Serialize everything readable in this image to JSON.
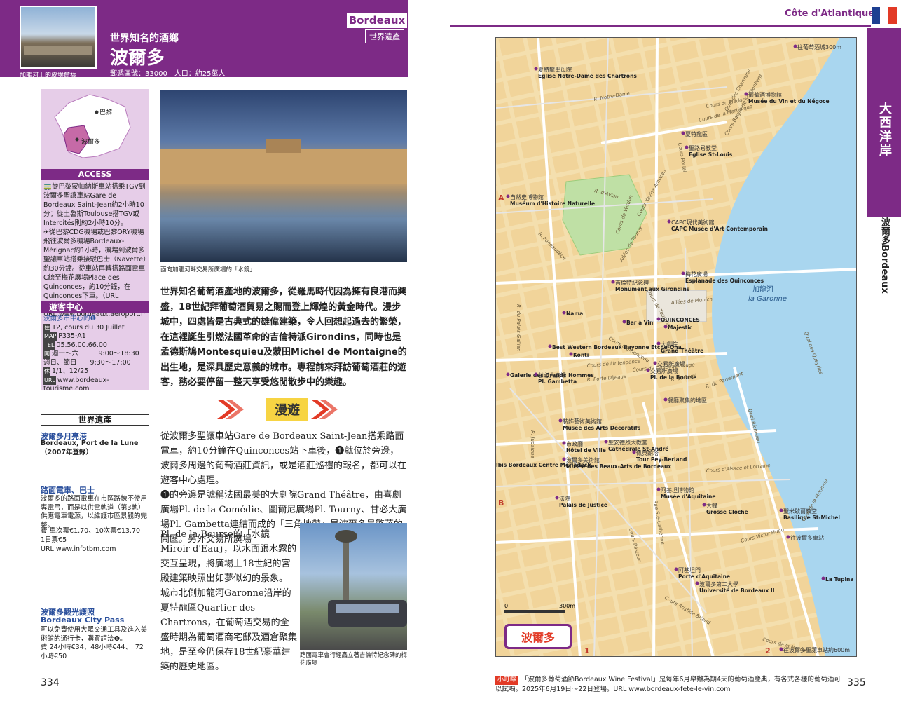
{
  "left": {
    "header": {
      "tag": "Bordeaux",
      "subtitle": "世界知名的酒鄉",
      "heritage_badge": "世界遺產",
      "title": "波爾多",
      "meta": "郵遞區號：33000　人口：約25萬人",
      "thumb_caption": "加龍河上的皮埃爾橋"
    },
    "sidebar": {
      "map_labels": [
        "巴黎",
        "波爾多"
      ],
      "access_title": "ACCESS",
      "access_text": "🚃從巴黎蒙帕納斯車站搭乘TGV到波爾多聖讓車站Gare de Bordeaux Saint-Jean約2小時10分；從土魯斯Toulouse搭TGV或Intercités則約2小時10分。\n✈從巴黎CDG機場或巴黎ORY機場飛往波爾多機場Bordeaux-Mérignac約1小時，機場到波爾多聖讓車站搭乘接駁巴士（Navette）約30分鐘。從車站再轉搭路面電車C線至梅花廣場Place des Quinconces，約10分鐘，在Quinconces下車。（URL www.infotbm.com）\nURL www.bordeaux.aeroport.fr",
      "info_title": "遊客中心",
      "info_office": "波爾多市中心的❶",
      "info_lines": [
        {
          "label": "住",
          "text": "12, cours du 30 Juillet"
        },
        {
          "label": "MAP",
          "text": "P335-A1"
        },
        {
          "label": "TEL",
          "text": "05.56.00.66.00"
        },
        {
          "label": "開",
          "text": "週一～六　　　9:00～18:30"
        },
        {
          "label": "",
          "text": "週日、節日　　9:30～17:00"
        },
        {
          "label": "休",
          "text": "1/1、12/25"
        },
        {
          "label": "URL",
          "text": "www.bordeaux-tourisme.com"
        }
      ]
    },
    "world_heritage": {
      "section_title": "世界遺產",
      "name_zh": "波爾多月亮港",
      "name_fr": "Bordeaux, Port de la Lune",
      "year": "（2007年登錄）"
    },
    "tram": {
      "title": "路面電車、巴士",
      "text": "波爾多的路面電車在市區路線不使用專電弓，而是以供電軌道（第3軌）供應電車電源，以維護市區景觀的完整。",
      "fares": "費 單次票€1.70、10次票€13.70　　1日票€5",
      "url": "URL www.infotbm.com"
    },
    "citypass": {
      "title": "波爾多觀光護照",
      "title_en": "Bordeaux City Pass",
      "text": "可以免費使用大眾交通工具及進入美術館的通行卡，購買請洽❶。",
      "fares": "費 24小時€34、48小時€44、　72小時€50"
    },
    "photo1_caption": "面向加龍河畔交易所廣場的「水鏡」",
    "intro": "世界知名葡萄酒產地的波爾多，從羅馬時代因為擁有良港而興盛，18世紀拜葡萄酒貿易之賜而登上輝煌的黃金時代。漫步城中，四處皆是古典式的雄偉建築，令人回想起過去的繁榮，在這裡誕生引燃法國革命的吉倫特派Girondins，同時也是孟德斯鳩Montesquieu及蒙田Michel de Montaigne的出生地，是深具歷史意義的城市。專程前來拜訪葡萄酒莊的遊客，務必要停留一整天享受悠閒散步中的樂趣。",
    "walk_label": "漫遊",
    "body1": "從波爾多聖讓車站Gare de Bordeaux Saint-Jean搭乘路面電車，約10分鐘在Quinconces站下車後，❶就位於旁邊，波爾多周邊的葡萄酒莊資訊，或是酒莊巡禮的報名，都可以在遊客中心處理。\n❶的旁邊是號稱法國最美的大劇院Grand Théâtre，由喜劇廣場Pl. de la Comédie、圖爾尼廣場Pl. Tourny、甘必大廣場Pl. Gambetta連結而成的「三角地帶」是波爾多最繁華的鬧區。另外交易所廣場",
    "body2": "Pl. de la Bourse的「水鏡Miroir d'Eau」，以水面跟水霧的交互呈現，將廣場上18世紀的宮殿建築映照出如夢似幻的景象。\n城市北側加龍河Garonne沿岸的夏特龍區Quartier des Chartrons，在葡萄酒交易的全盛時期為葡萄酒商宅邸及酒倉聚集地，是至今仍保存18世紀豪華建築的歷史地區。",
    "photo2_caption": "路面電車會行經矗立著吉倫特紀念碑的梅花廣場",
    "page_number": "334"
  },
  "right": {
    "header_title": "Côte d'Atlantique",
    "tab_region": "大西洋岸",
    "tab_city": "波爾多Bordeaux",
    "map": {
      "city_badge": "波爾多",
      "scale_start": "0",
      "scale_end": "300m",
      "grid": [
        "A",
        "B",
        "1",
        "2"
      ],
      "river_zh": "加龍河",
      "river_fr": "la Garonne",
      "labels": [
        {
          "zh": "往葡萄酒城300m",
          "fr": ""
        },
        {
          "zh": "夏特龍聖母院",
          "fr": "Eglise Notre-Dame des Chartrons"
        },
        {
          "zh": "葡萄酒博物館",
          "fr": "Musée du Vin et du Négoce"
        },
        {
          "zh": "夏特龍區",
          "fr": ""
        },
        {
          "zh": "聖路易教堂",
          "fr": "Eglise St-Louis"
        },
        {
          "zh": "自然史博物館",
          "fr": "Muséum d'Histoire Naturelle"
        },
        {
          "zh": "CAPC現代美術館",
          "fr": "CAPC Musée d'Art Contemporain"
        },
        {
          "zh": "梅花廣場",
          "fr": "Esplanade des Quinconces"
        },
        {
          "zh": "吉倫特紀念碑",
          "fr": "Monument aux Girondins"
        },
        {
          "zh": "",
          "fr": "QUINCONCES"
        },
        {
          "zh": "大劇院",
          "fr": "Grand Théâtre"
        },
        {
          "zh": "",
          "fr": "Galerie des Grands Hommes"
        },
        {
          "zh": "",
          "fr": "Best Western Bordeaux Bayonne Etche-Ona"
        },
        {
          "zh": "交易所廣場",
          "fr": "Pl. de la Bourse"
        },
        {
          "zh": "甘必大廣場",
          "fr": "Pl. Gambetta"
        },
        {
          "zh": "裝飾藝術美術館",
          "fr": "Musée des Arts Décoratifs"
        },
        {
          "zh": "聖安德烈大教堂",
          "fr": "Cathédrale St-André"
        },
        {
          "zh": "佩貝朗塔",
          "fr": "Tour Pey-Berland"
        },
        {
          "zh": "市政廳",
          "fr": "Hôtel de Ville"
        },
        {
          "zh": "波爾多美術館",
          "fr": "Musée des Beaux-Arts de Bordeaux"
        },
        {
          "zh": "",
          "fr": "Ibis Bordeaux Centre Mériadeck"
        },
        {
          "zh": "法院",
          "fr": "Palais de Justice"
        },
        {
          "zh": "阿基坦博物館",
          "fr": "Musée d'Aquitaine"
        },
        {
          "zh": "大鐘",
          "fr": "Grosse Cloche"
        },
        {
          "zh": "聖米歇爾教堂",
          "fr": "Basilique St-Michel"
        },
        {
          "zh": "阿基坦門",
          "fr": "Porte d'Aquitaine"
        },
        {
          "zh": "波爾多第二大學",
          "fr": "Université de Bordeaux II"
        },
        {
          "zh": "往波爾多聖讓車站約600m",
          "fr": ""
        },
        {
          "zh": "往波爾多車站",
          "fr": ""
        },
        {
          "zh": "餐廳聚集的地區",
          "fr": ""
        },
        {
          "zh": "交易所廣場",
          "fr": ""
        },
        {
          "zh": "",
          "fr": "Nama"
        },
        {
          "zh": "",
          "fr": "Bar à Vin"
        },
        {
          "zh": "",
          "fr": "Majestic"
        },
        {
          "zh": "",
          "fr": "Konti"
        },
        {
          "zh": "",
          "fr": "La Tupina"
        }
      ],
      "streets": [
        "Cours Xavier Arnozan",
        "Quai des Chartrons",
        "Cours de Verdun",
        "Allées de Tourny",
        "Cours du Chapeau Rouge",
        "Cours de l'Intendance",
        "Rue Ste-Catherine",
        "Cours Victor Hugo",
        "Cours Pasteur",
        "Cours Aristide Briand",
        "Cours d'Alsace et Lorraine",
        "Quai Richelieu",
        "Allées de Munich",
        "Cours Portal",
        "Cours de la Martinique",
        "R. Notre-Dame",
        "Cours du Médoc",
        "Cours Balguerie Stuttenberg",
        "R. Fondaudège",
        "Quai des Queyries",
        "Cours de Tournon",
        "R. du Palais Gallien",
        "R. d'Aviau",
        "R. Judaïque",
        "Cours de la Marne",
        "Quai de la Monnaie",
        "R. du Parlement",
        "R. St-Rémi",
        "R. Porte Dijeaux",
        "Cours Clémenceau"
      ],
      "flag_colors": [
        "#1d3f91",
        "#ffffff",
        "#e23a26"
      ]
    },
    "tip": {
      "badge": "小叮嚀",
      "text": "「波爾多葡萄酒節Bordeaux Wine Festival」是每年6月舉辦為期4天的葡萄酒慶典，有各式各樣的葡萄酒可以試喝。2025年6月19日～22日登場。URL www.bordeaux-fete-le-vin.com"
    },
    "page_number": "335"
  }
}
